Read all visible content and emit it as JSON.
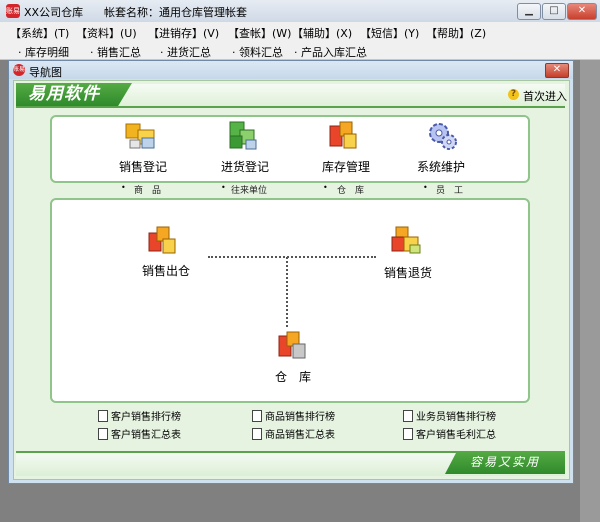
{
  "window": {
    "app_title": "XX公司仓库",
    "account_label": "帐套名称：通用仓库管理帐套",
    "logo_text": "账易",
    "minimize": "▁",
    "maximize": "□",
    "close": "✕"
  },
  "menu": [
    "【系统】(T)",
    "【资料】(U)",
    "【进销存】(V)",
    "【查帐】(W)",
    "【辅助】(X)",
    "【短信】(Y)",
    "【帮助】(Z)"
  ],
  "toolbar": [
    "· 库存明细",
    "· 销售汇总",
    "· 进货汇总",
    "· 领料汇总",
    "· 产品入库汇总"
  ],
  "child": {
    "title": "导航图",
    "close": "✕",
    "banner_title": "易用软件",
    "help_label": "首次进入",
    "footer_slogan": "容易又实用"
  },
  "modules": [
    {
      "label": "销售登记",
      "sub": "商　品",
      "icon": "sales-register-icon"
    },
    {
      "label": "进货登记",
      "sub": "往来单位",
      "icon": "purchase-register-icon"
    },
    {
      "label": "库存管理",
      "sub": "仓　库",
      "icon": "inventory-icon"
    },
    {
      "label": "系统维护",
      "sub": "员　工",
      "icon": "system-maintenance-icon"
    }
  ],
  "flow": {
    "sales_out": "销售出仓",
    "sales_return": "销售退货",
    "warehouse": "仓　库"
  },
  "reports": [
    "客户销售排行榜",
    "商品销售排行榜",
    "业务员销售排行榜",
    "客户销售汇总表",
    "商品销售汇总表",
    "客户销售毛利汇总"
  ],
  "colors": {
    "accent_green": "#3d9636",
    "panel_border": "#8fc48a",
    "close_red": "#c9402d"
  }
}
